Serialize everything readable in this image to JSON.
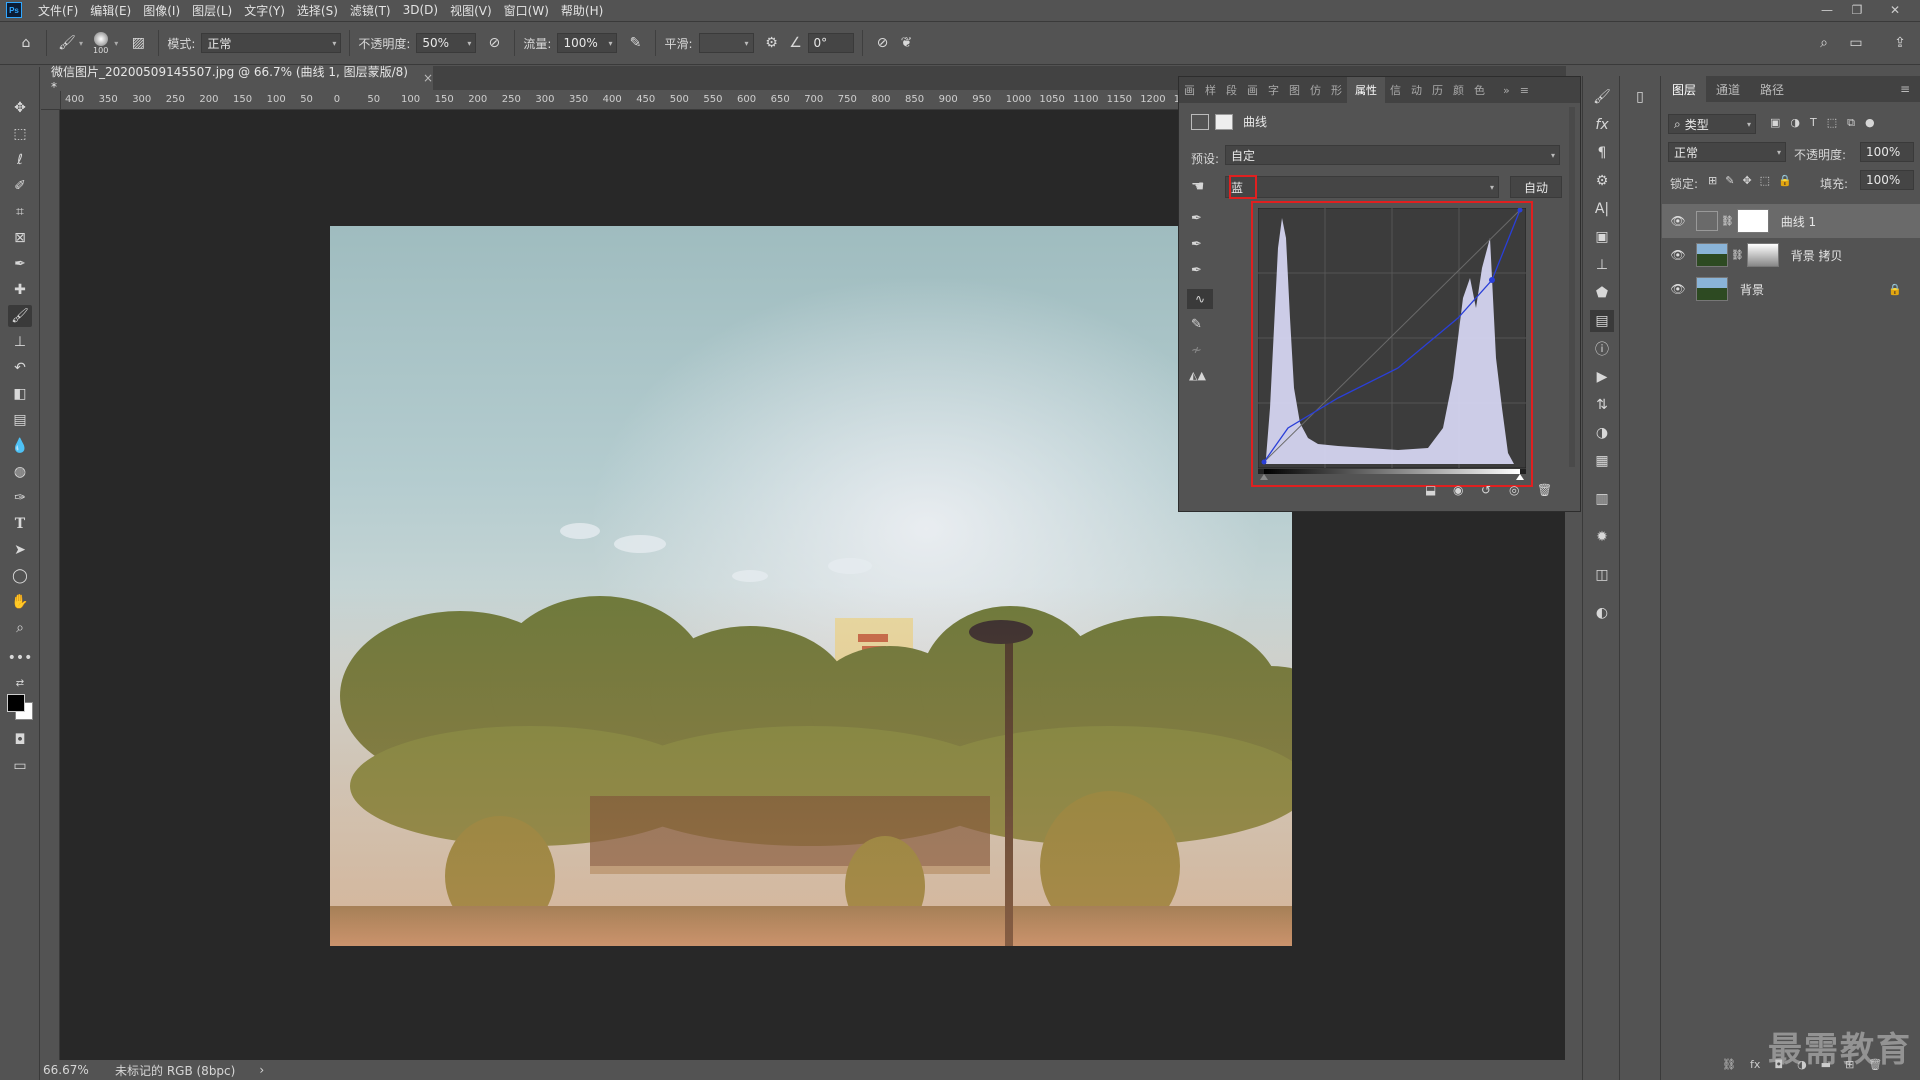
{
  "app": {
    "logo_text": "Ps"
  },
  "menu": [
    "文件(F)",
    "编辑(E)",
    "图像(I)",
    "图层(L)",
    "文字(Y)",
    "选择(S)",
    "滤镜(T)",
    "3D(D)",
    "视图(V)",
    "窗口(W)",
    "帮助(H)"
  ],
  "options": {
    "brush_size": "100",
    "mode_label": "模式:",
    "mode_value": "正常",
    "opacity_label": "不透明度:",
    "opacity_value": "50%",
    "flow_label": "流量:",
    "flow_value": "100%",
    "smooth_label": "平滑:",
    "angle_value": "0°"
  },
  "document": {
    "tab_title": "微信图片_20200509145507.jpg @ 66.7% (曲线 1, 图层蒙版/8) *",
    "ruler_ticks": [
      "400",
      "350",
      "300",
      "250",
      "200",
      "150",
      "100",
      "50",
      "0",
      "50",
      "100",
      "150",
      "200",
      "250",
      "300",
      "350",
      "400",
      "450",
      "500",
      "550",
      "600",
      "650",
      "700",
      "750",
      "800",
      "850",
      "900",
      "950",
      "1000",
      "1050",
      "1100",
      "1150",
      "1200",
      "12"
    ]
  },
  "status": {
    "zoom": "66.67%",
    "profile": "未标记的 RGB (8bpc)",
    "arrow": "›"
  },
  "properties": {
    "tabs": [
      "画",
      "样",
      "段",
      "画",
      "字",
      "图",
      "仿",
      "形",
      "属性",
      "信",
      "动",
      "历",
      "颜",
      "色"
    ],
    "active_tab": "属性",
    "title": "曲线",
    "preset_label": "预设:",
    "preset_value": "自定",
    "channel_value": "蓝",
    "auto_button": "自动"
  },
  "layers_panel": {
    "tabs": [
      "图层",
      "通道",
      "路径"
    ],
    "filter_label": "类型",
    "blend_mode": "正常",
    "opacity_label": "不透明度:",
    "opacity_value": "100%",
    "lock_label": "锁定:",
    "fill_label": "填充:",
    "fill_value": "100%",
    "layers": [
      {
        "name": "曲线 1",
        "selected": true
      },
      {
        "name": "背景 拷贝",
        "selected": false
      },
      {
        "name": "背景",
        "selected": false
      }
    ]
  },
  "watermark": "最需教育",
  "colors": {
    "highlight_box": "#e02020",
    "curve_line": "#2a3fd8",
    "histogram_fill": "#dcdcfa"
  }
}
